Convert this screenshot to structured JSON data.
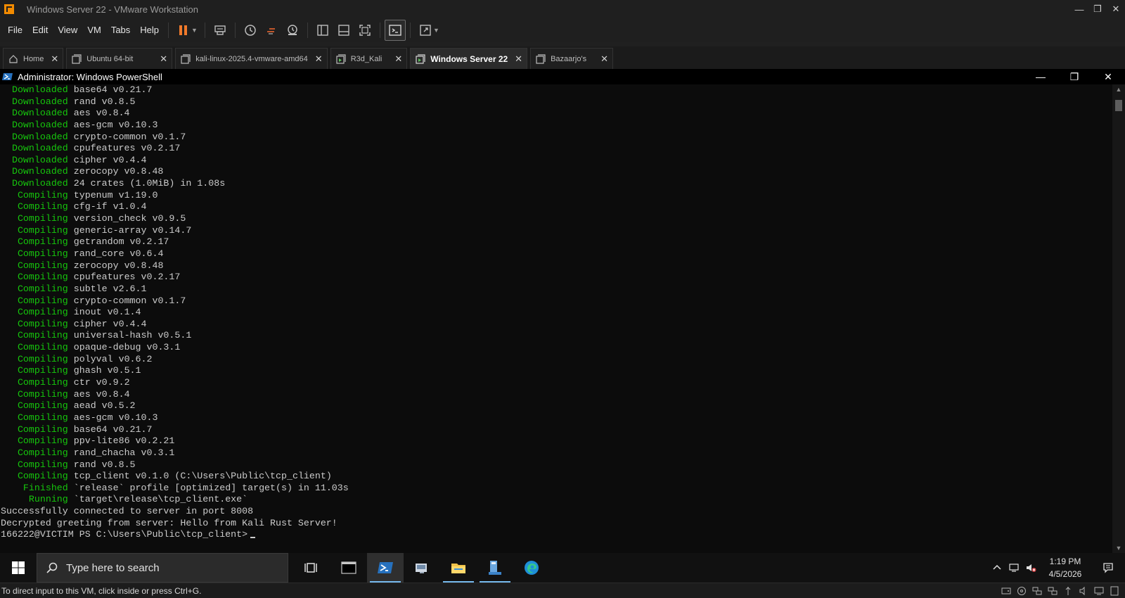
{
  "window": {
    "title": "Windows Server 22 - VMware Workstation"
  },
  "menu": [
    "File",
    "Edit",
    "View",
    "VM",
    "Tabs",
    "Help"
  ],
  "tabs": [
    {
      "label": "Home",
      "icon": "home-icon"
    },
    {
      "label": "Ubuntu 64-bit",
      "icon": "vm-icon"
    },
    {
      "label": "kali-linux-2025.4-vmware-amd64",
      "icon": "vm-icon"
    },
    {
      "label": "R3d_Kali",
      "icon": "vm-running-icon"
    },
    {
      "label": "Windows Server 22",
      "icon": "vm-running-icon",
      "active": true
    },
    {
      "label": "Bazaarjo's",
      "icon": "vm-icon"
    }
  ],
  "powershell": {
    "title": "Administrator: Windows PowerShell",
    "lines": [
      {
        "pad": "  ",
        "kw": "Downloaded",
        "text": " base64 v0.21.7"
      },
      {
        "pad": "  ",
        "kw": "Downloaded",
        "text": " rand v0.8.5"
      },
      {
        "pad": "  ",
        "kw": "Downloaded",
        "text": " aes v0.8.4"
      },
      {
        "pad": "  ",
        "kw": "Downloaded",
        "text": " aes-gcm v0.10.3"
      },
      {
        "pad": "  ",
        "kw": "Downloaded",
        "text": " crypto-common v0.1.7"
      },
      {
        "pad": "  ",
        "kw": "Downloaded",
        "text": " cpufeatures v0.2.17"
      },
      {
        "pad": "  ",
        "kw": "Downloaded",
        "text": " cipher v0.4.4"
      },
      {
        "pad": "  ",
        "kw": "Downloaded",
        "text": " zerocopy v0.8.48"
      },
      {
        "pad": "  ",
        "kw": "Downloaded",
        "text": " 24 crates (1.0MiB) in 1.08s"
      },
      {
        "pad": "   ",
        "kw": "Compiling",
        "text": " typenum v1.19.0"
      },
      {
        "pad": "   ",
        "kw": "Compiling",
        "text": " cfg-if v1.0.4"
      },
      {
        "pad": "   ",
        "kw": "Compiling",
        "text": " version_check v0.9.5"
      },
      {
        "pad": "   ",
        "kw": "Compiling",
        "text": " generic-array v0.14.7"
      },
      {
        "pad": "   ",
        "kw": "Compiling",
        "text": " getrandom v0.2.17"
      },
      {
        "pad": "   ",
        "kw": "Compiling",
        "text": " rand_core v0.6.4"
      },
      {
        "pad": "   ",
        "kw": "Compiling",
        "text": " zerocopy v0.8.48"
      },
      {
        "pad": "   ",
        "kw": "Compiling",
        "text": " cpufeatures v0.2.17"
      },
      {
        "pad": "   ",
        "kw": "Compiling",
        "text": " subtle v2.6.1"
      },
      {
        "pad": "   ",
        "kw": "Compiling",
        "text": " crypto-common v0.1.7"
      },
      {
        "pad": "   ",
        "kw": "Compiling",
        "text": " inout v0.1.4"
      },
      {
        "pad": "   ",
        "kw": "Compiling",
        "text": " cipher v0.4.4"
      },
      {
        "pad": "   ",
        "kw": "Compiling",
        "text": " universal-hash v0.5.1"
      },
      {
        "pad": "   ",
        "kw": "Compiling",
        "text": " opaque-debug v0.3.1"
      },
      {
        "pad": "   ",
        "kw": "Compiling",
        "text": " polyval v0.6.2"
      },
      {
        "pad": "   ",
        "kw": "Compiling",
        "text": " ghash v0.5.1"
      },
      {
        "pad": "   ",
        "kw": "Compiling",
        "text": " ctr v0.9.2"
      },
      {
        "pad": "   ",
        "kw": "Compiling",
        "text": " aes v0.8.4"
      },
      {
        "pad": "   ",
        "kw": "Compiling",
        "text": " aead v0.5.2"
      },
      {
        "pad": "   ",
        "kw": "Compiling",
        "text": " aes-gcm v0.10.3"
      },
      {
        "pad": "   ",
        "kw": "Compiling",
        "text": " base64 v0.21.7"
      },
      {
        "pad": "   ",
        "kw": "Compiling",
        "text": " ppv-lite86 v0.2.21"
      },
      {
        "pad": "   ",
        "kw": "Compiling",
        "text": " rand_chacha v0.3.1"
      },
      {
        "pad": "   ",
        "kw": "Compiling",
        "text": " rand v0.8.5"
      },
      {
        "pad": "   ",
        "kw": "Compiling",
        "text": " tcp_client v0.1.0 (C:\\Users\\Public\\tcp_client)"
      },
      {
        "pad": "    ",
        "kw": "Finished",
        "text": " `release` profile [optimized] target(s) in 11.03s"
      },
      {
        "pad": "     ",
        "kw": "Running",
        "text": " `target\\release\\tcp_client.exe`"
      },
      {
        "pad": "",
        "kw": "",
        "text": "Successfully connected to server in port 8008"
      },
      {
        "pad": "",
        "kw": "",
        "text": "Decrypted greeting from server: Hello from Kali Rust Server!"
      },
      {
        "pad": "",
        "kw": "",
        "text": "166222@VICTIM PS C:\\Users\\Public\\tcp_client>",
        "cursor": true
      }
    ]
  },
  "taskbar": {
    "search_placeholder": "Type here to search",
    "time": "1:19 PM",
    "date": "4/5/2026"
  },
  "statusbar": {
    "text": "To direct input to this VM, click inside or press Ctrl+G."
  },
  "colors": {
    "accent_green": "#16c60c",
    "ps_blue": "#2671be",
    "taskbar_highlight": "#76b9ed"
  }
}
